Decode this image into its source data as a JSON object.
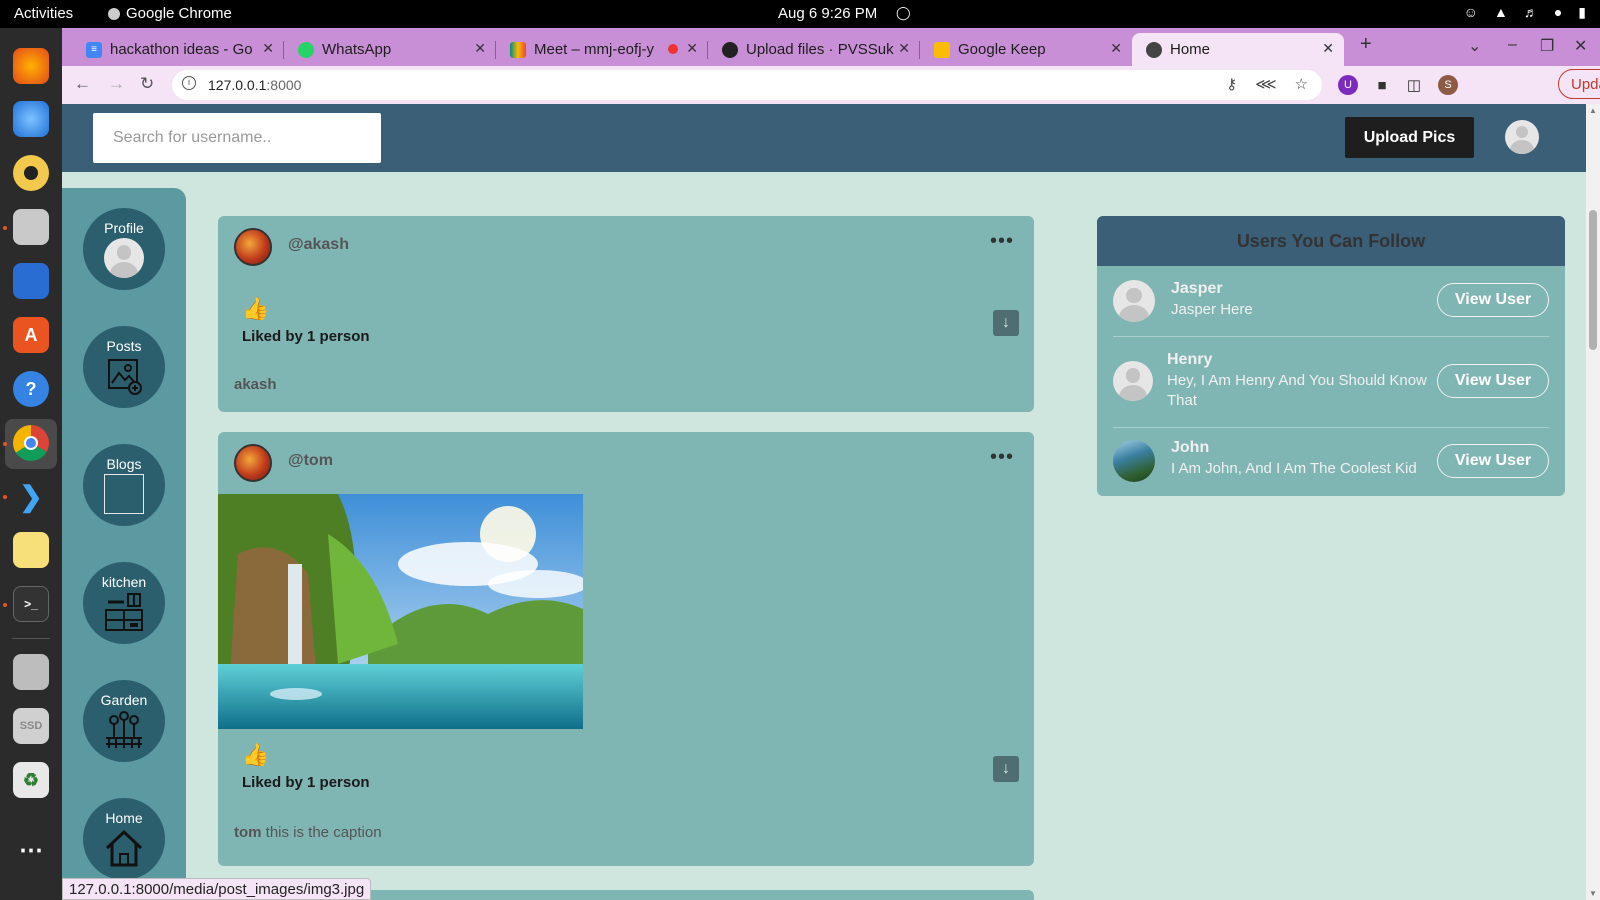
{
  "system": {
    "activities": "Activities",
    "app_name": "Google Chrome",
    "clock": "Aug 6  9:26 PM"
  },
  "browser": {
    "tabs": [
      {
        "title": "hackathon ideas - Go",
        "icon": "docs-icon",
        "color": "#4285f4"
      },
      {
        "title": "WhatsApp",
        "icon": "whatsapp-icon",
        "color": "#25d366"
      },
      {
        "title": "Meet – mmj-eofj-y",
        "icon": "meet-icon",
        "color": "#00897b"
      },
      {
        "title": "Upload files · PVSSuk",
        "icon": "github-icon",
        "color": "#222222"
      },
      {
        "title": "Google Keep",
        "icon": "keep-icon",
        "color": "#fbbc04"
      },
      {
        "title": "Home",
        "icon": "globe-icon",
        "color": "#444444"
      }
    ],
    "url_host": "127.0.0.1",
    "url_port": ":8000",
    "update_label": "Update",
    "profile_initial": "S",
    "status_url": "127.0.0.1:8000/media/post_images/img3.jpg"
  },
  "page": {
    "search_placeholder": "Search for username..",
    "upload_label": "Upload Pics",
    "menu": [
      {
        "label": "Profile",
        "icon": "profile-avatar-icon"
      },
      {
        "label": "Posts",
        "icon": "image-add-icon"
      },
      {
        "label": "Blogs",
        "icon": "broken-image-icon"
      },
      {
        "label": "kitchen",
        "icon": "kitchen-icon"
      },
      {
        "label": "Garden",
        "icon": "garden-icon"
      },
      {
        "label": "Home",
        "icon": "home-icon"
      }
    ],
    "posts": [
      {
        "username": "@akash",
        "liked_text": "Liked by 1 person",
        "caption_user": "akash",
        "caption_text": ""
      },
      {
        "username": "@tom",
        "liked_text": "Liked by 1 person",
        "caption_user": "tom",
        "caption_text": " this is the caption"
      }
    ],
    "follow": {
      "title": "Users You Can Follow",
      "users": [
        {
          "name": "Jasper",
          "bio": "Jasper Here",
          "button": "View User"
        },
        {
          "name": "Henry",
          "bio": "Hey, I Am Henry And You Should Know That",
          "button": "View User"
        },
        {
          "name": "John",
          "bio": "I Am John, And I Am The Coolest Kid",
          "button": "View User"
        }
      ]
    }
  },
  "colors": {
    "header": "#3a5f77",
    "card": "#7fb6b3",
    "background": "#cfe6de",
    "tab_strip": "#c98fd6"
  }
}
